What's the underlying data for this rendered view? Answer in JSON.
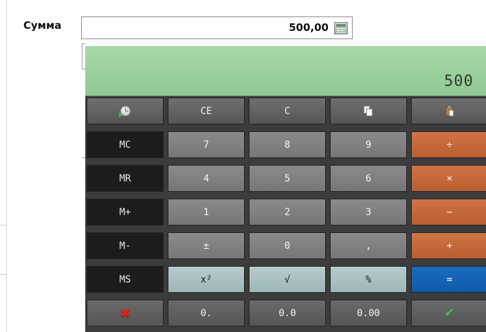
{
  "amount": {
    "label": "Сумма",
    "value": "500,00",
    "calculator_icon": "calculator-icon"
  },
  "calculator": {
    "display": "500",
    "rows": [
      [
        {
          "name": "history-button",
          "icon": "history-icon"
        },
        {
          "name": "ce-button",
          "label": "CE"
        },
        {
          "name": "c-button",
          "label": "C"
        },
        {
          "name": "copy-button",
          "icon": "copy-icon"
        },
        {
          "name": "paste-button",
          "icon": "paste-icon"
        }
      ],
      [
        {
          "name": "mc-button",
          "label": "MC"
        },
        {
          "name": "seven-button",
          "label": "7"
        },
        {
          "name": "eight-button",
          "label": "8"
        },
        {
          "name": "nine-button",
          "label": "9"
        },
        {
          "name": "divide-button",
          "label": "÷"
        }
      ],
      [
        {
          "name": "mr-button",
          "label": "MR"
        },
        {
          "name": "four-button",
          "label": "4"
        },
        {
          "name": "five-button",
          "label": "5"
        },
        {
          "name": "six-button",
          "label": "6"
        },
        {
          "name": "multiply-button",
          "label": "×"
        }
      ],
      [
        {
          "name": "m-plus-button",
          "label": "M+"
        },
        {
          "name": "one-button",
          "label": "1"
        },
        {
          "name": "two-button",
          "label": "2"
        },
        {
          "name": "three-button",
          "label": "3"
        },
        {
          "name": "minus-button",
          "label": "−"
        }
      ],
      [
        {
          "name": "m-minus-button",
          "label": "M-"
        },
        {
          "name": "plus-minus-button",
          "label": "±"
        },
        {
          "name": "zero-button",
          "label": "0"
        },
        {
          "name": "decimal-separator-button",
          "label": ","
        },
        {
          "name": "plus-button",
          "label": "+"
        }
      ],
      [
        {
          "name": "ms-button",
          "label": "MS"
        },
        {
          "name": "square-button",
          "label": "x²"
        },
        {
          "name": "sqrt-button",
          "label": "√"
        },
        {
          "name": "percent-button",
          "label": "%"
        },
        {
          "name": "equals-button",
          "label": "="
        }
      ],
      [
        {
          "name": "cancel-button",
          "icon": "close-icon"
        },
        {
          "name": "format-0-dot-button",
          "label": "0."
        },
        {
          "name": "format-0-0-button",
          "label": "0.0"
        },
        {
          "name": "format-0-00-button",
          "label": "0.00"
        },
        {
          "name": "ok-button",
          "icon": "checkmark-icon"
        }
      ]
    ]
  },
  "colors": {
    "display_bg": "#a6d9a6",
    "operator_orange": "#c5693a",
    "equals_blue": "#1565b5",
    "memory_dark": "#1c1c1c"
  }
}
